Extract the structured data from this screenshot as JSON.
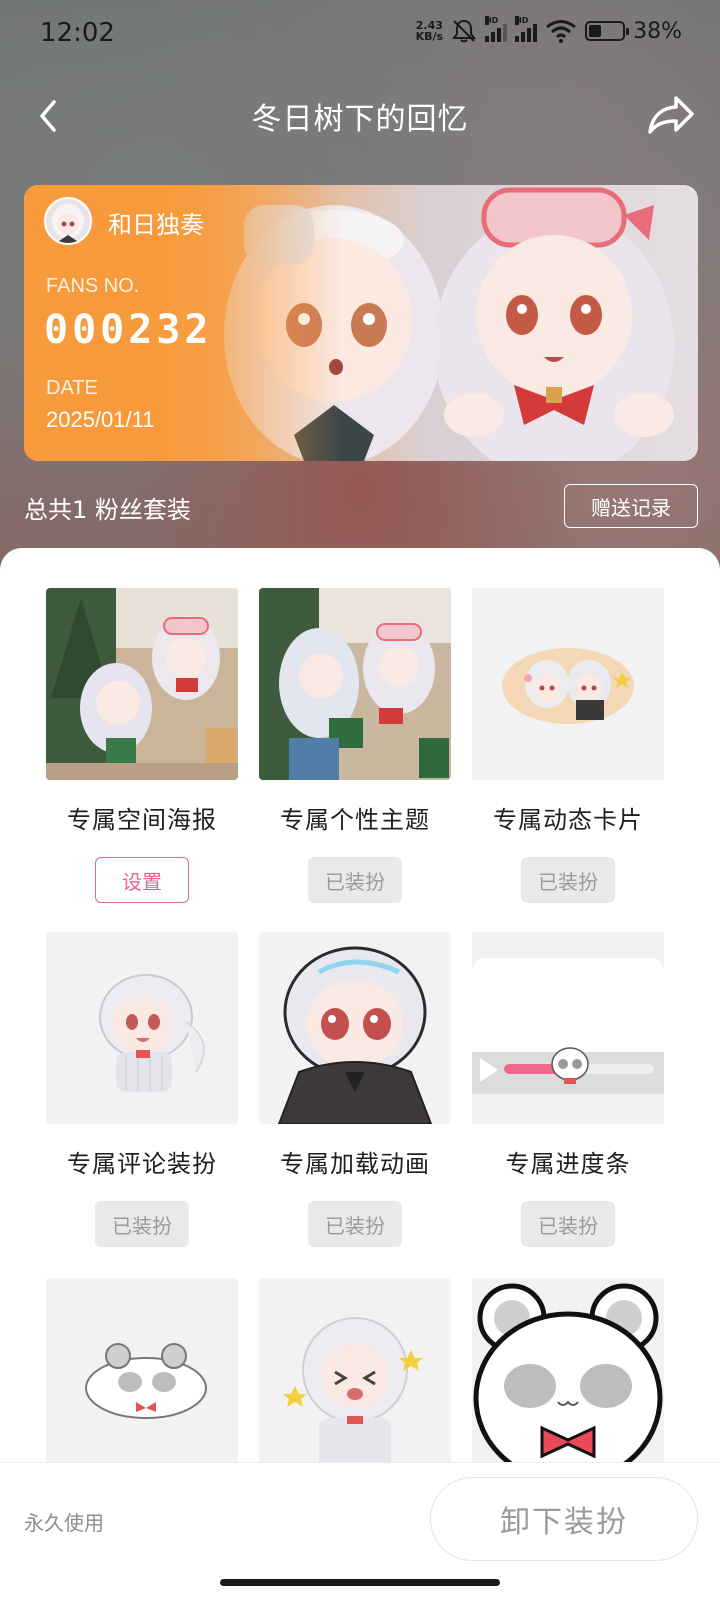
{
  "status_bar": {
    "time": "12:02",
    "net_speed_value": "2.43",
    "net_speed_unit": "KB/s",
    "hd1": "HD",
    "hd2": "HD",
    "wifi_sub": "6",
    "battery": "38%"
  },
  "nav": {
    "title": "冬日树下的回忆"
  },
  "fan_card": {
    "user_name": "和日独奏",
    "fans_no_label": "FANS NO.",
    "fans_no": "000232",
    "date_label": "DATE",
    "date": "2025/01/11"
  },
  "summary": {
    "count_text": "总共1 粉丝套装",
    "gift_record_label": "赠送记录"
  },
  "items": [
    {
      "title": "专属空间海报",
      "button": "设置",
      "state": "set"
    },
    {
      "title": "专属个性主题",
      "button": "已装扮",
      "state": "equipped"
    },
    {
      "title": "专属动态卡片",
      "button": "已装扮",
      "state": "equipped"
    },
    {
      "title": "专属评论装扮",
      "button": "已装扮",
      "state": "equipped"
    },
    {
      "title": "专属加载动画",
      "button": "已装扮",
      "state": "equipped"
    },
    {
      "title": "专属进度条",
      "button": "已装扮",
      "state": "equipped"
    },
    {
      "title": "",
      "button": "",
      "state": "partial"
    },
    {
      "title": "",
      "button": "",
      "state": "partial"
    },
    {
      "title": "",
      "button": "",
      "state": "partial"
    }
  ],
  "bottom": {
    "permanent_label": "永久使用",
    "unequip_label": "卸下装扮"
  },
  "colors": {
    "accent_pink": "#e5678f",
    "card_orange": "#f59a3c"
  },
  "icons": [
    "back-icon",
    "share-icon",
    "wifi-icon",
    "mute-icon",
    "battery-icon"
  ]
}
